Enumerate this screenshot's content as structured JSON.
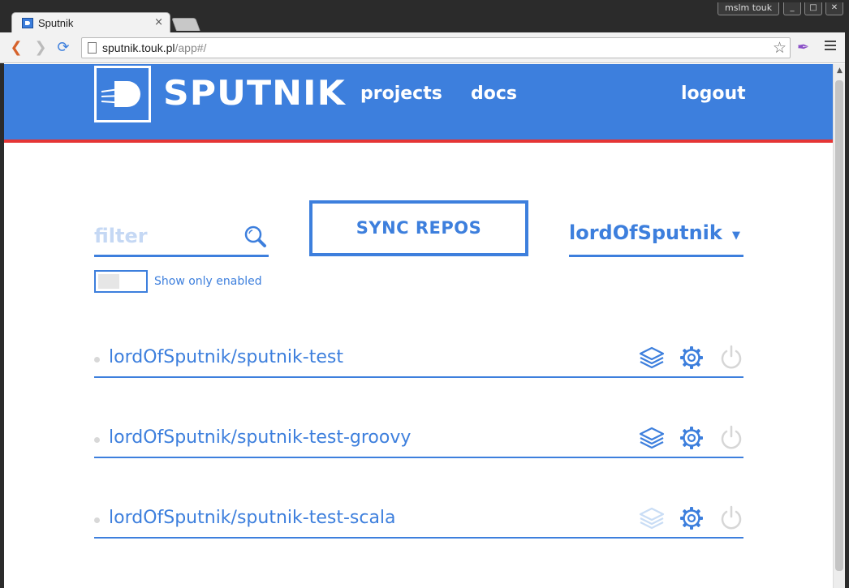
{
  "window": {
    "user": "mslm touk",
    "buttons": [
      "_",
      "□",
      "✕"
    ]
  },
  "browser": {
    "tab_title": "Sputnik",
    "tab_close": "×",
    "url_host": "sputnik.touk.pl",
    "url_path": "/app#/"
  },
  "header": {
    "brand": "SPUTNIK",
    "nav": [
      "projects",
      "docs"
    ],
    "logout": "logout"
  },
  "controls": {
    "filter_placeholder": "filter",
    "sync_label": "SYNC REPOS",
    "user": "lordOfSputnik",
    "toggle_label": "Show only enabled"
  },
  "repos": [
    {
      "name": "lordOfSputnik/sputnik-test",
      "layers_enabled": true,
      "power_enabled": false
    },
    {
      "name": "lordOfSputnik/sputnik-test-groovy",
      "layers_enabled": true,
      "power_enabled": false
    },
    {
      "name": "lordOfSputnik/sputnik-test-scala",
      "layers_enabled": false,
      "power_enabled": false
    }
  ],
  "colors": {
    "primary": "#3d7fdd",
    "accent_line": "#e53535",
    "disabled": "#c9ddf5",
    "power": "#d6d6d6"
  },
  "icons": {
    "layers": "layers-icon",
    "settings": "gear-icon",
    "power": "power-icon",
    "search": "search-icon"
  }
}
